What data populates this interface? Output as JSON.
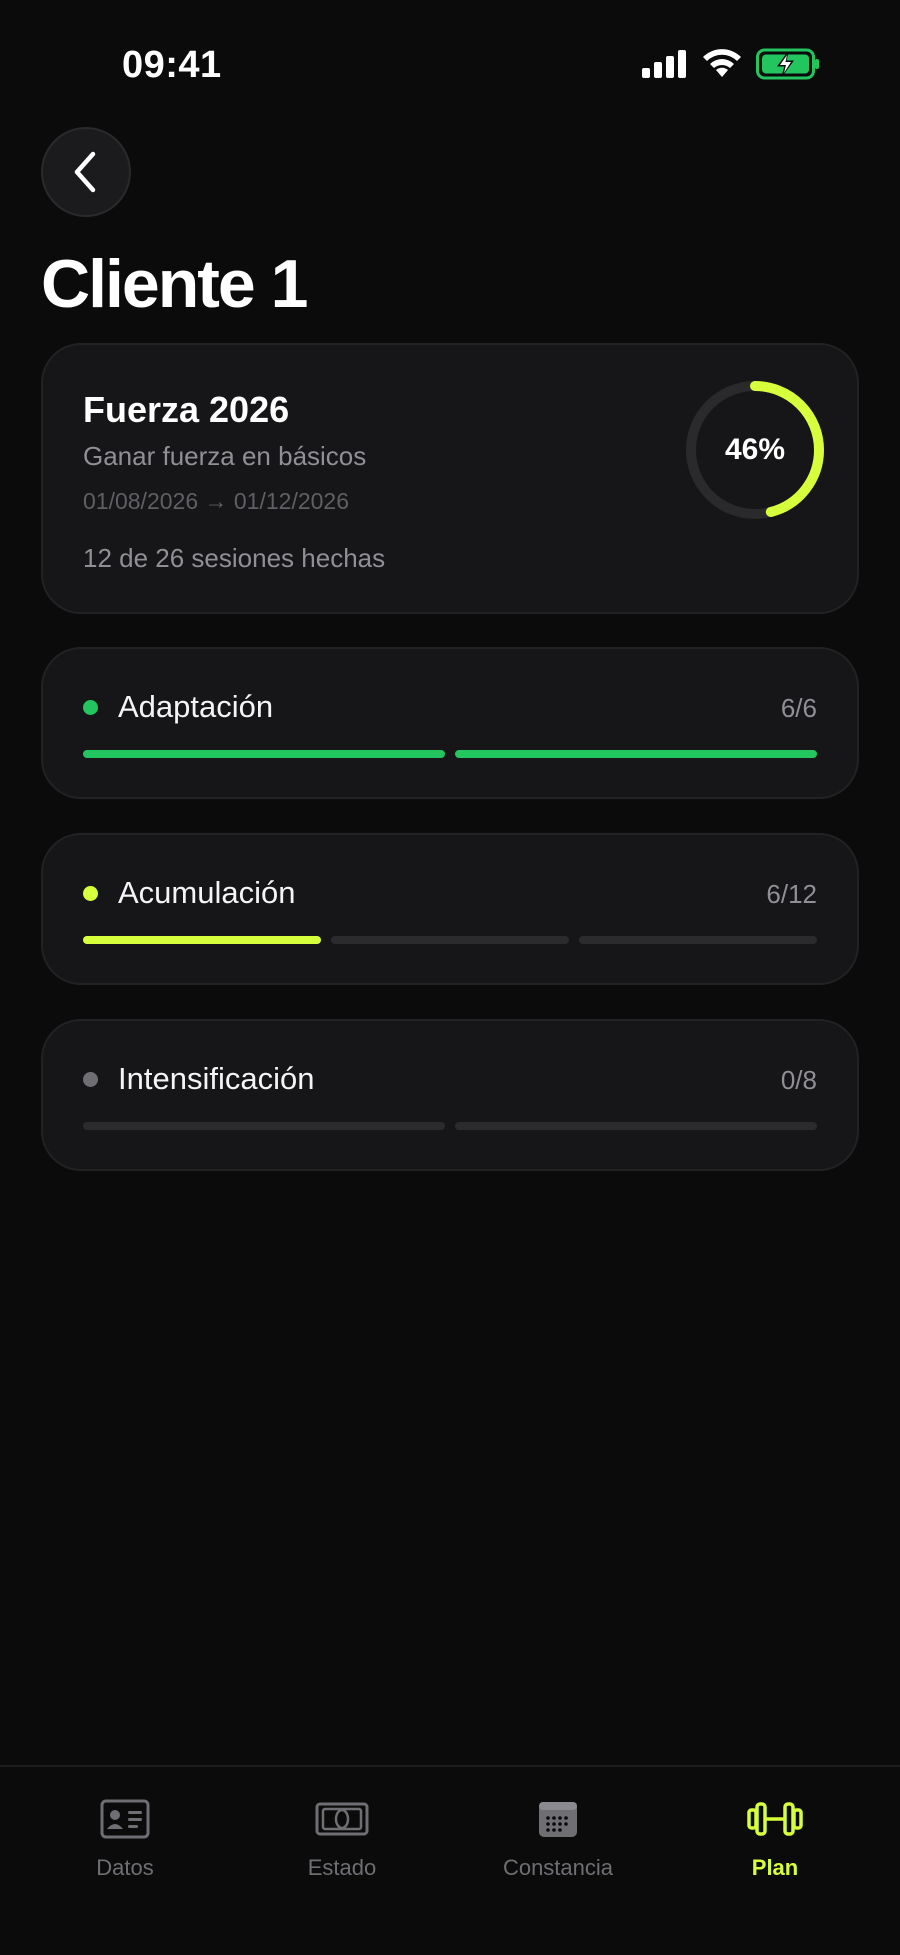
{
  "status": {
    "time": "09:41"
  },
  "header": {
    "title": "Cliente 1"
  },
  "plan": {
    "name": "Fuerza 2026",
    "goal": "Ganar fuerza en básicos",
    "dates": "01/08/2026 → 01/12/2026",
    "sessions": "12 de 26 sesiones hechas",
    "progress_label": "46%",
    "progress": 0.46,
    "ring_color": "#d7ff3c"
  },
  "phases": [
    {
      "name": "Adaptación",
      "count": "6/6",
      "color": "#22c55e",
      "segments": 2,
      "filled": 2
    },
    {
      "name": "Acumulación",
      "count": "6/12",
      "color": "#d7ff3c",
      "segments": 3,
      "filled": 1
    },
    {
      "name": "Intensificación",
      "count": "0/8",
      "color": "#6e6e73",
      "segments": 2,
      "filled": 0
    }
  ],
  "tabs": [
    {
      "label": "Datos",
      "icon": "id-card-icon",
      "active": false
    },
    {
      "label": "Estado",
      "icon": "body-scan-icon",
      "active": false
    },
    {
      "label": "Constancia",
      "icon": "calendar-icon",
      "active": false
    },
    {
      "label": "Plan",
      "icon": "dumbbell-icon",
      "active": true
    }
  ],
  "colors": {
    "accent": "#d7ff3c",
    "success": "#22c55e",
    "background": "#0b0b0c",
    "card": "#161618"
  }
}
